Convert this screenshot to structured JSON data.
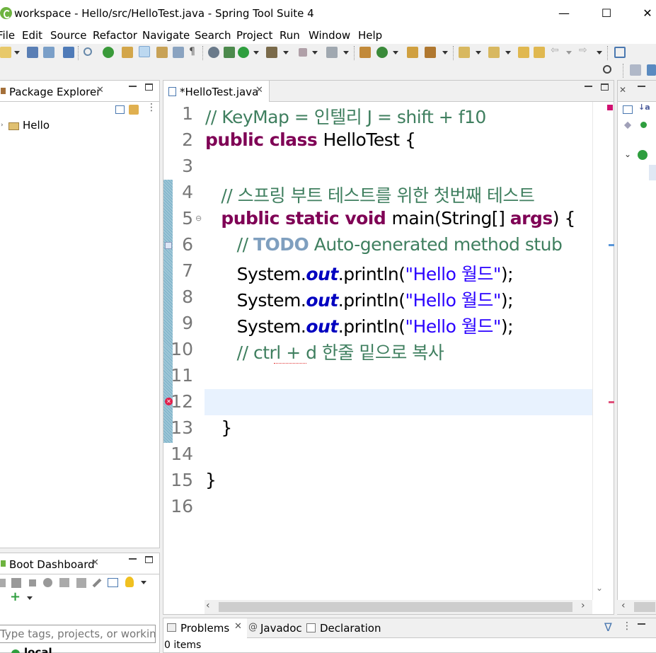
{
  "window": {
    "title": "workspace - Hello/src/HelloTest.java - Spring Tool Suite 4",
    "minimize": "—",
    "maximize": "☐",
    "close": "✕"
  },
  "menu": [
    "File",
    "Edit",
    "Source",
    "Refactor",
    "Navigate",
    "Search",
    "Project",
    "Run",
    "Window",
    "Help"
  ],
  "package_explorer": {
    "title": "Package Explorer",
    "items": [
      {
        "label": "Hello"
      }
    ]
  },
  "boot_dashboard": {
    "title": "Boot Dashboard",
    "filter_placeholder": "Type tags, projects, or working s",
    "local_label": "local"
  },
  "editor": {
    "tab_label": "*HelloTest.java",
    "line_numbers": [
      "1",
      "2",
      "3",
      "4",
      "5",
      "6",
      "7",
      "8",
      "9",
      "10",
      "11",
      "12",
      "13",
      "14",
      "15",
      "16"
    ],
    "lines": [
      {
        "segments": [
          {
            "t": "// KeyMap = 인텔리 J = shift + f10",
            "c": "cm"
          }
        ]
      },
      {
        "segments": [
          {
            "t": "public class ",
            "c": "kw"
          },
          {
            "t": "HelloTest {",
            "c": ""
          }
        ]
      },
      {
        "segments": []
      },
      {
        "segments": [
          {
            "t": "   // 스프링 부트 테스트를 위한 첫번째 테스트",
            "c": "cm"
          }
        ]
      },
      {
        "segments": [
          {
            "t": "   ",
            "c": ""
          },
          {
            "t": "public static void ",
            "c": "kw"
          },
          {
            "t": "main(String[] ",
            "c": ""
          },
          {
            "t": "args",
            "c": "kw"
          },
          {
            "t": ") {",
            "c": ""
          }
        ]
      },
      {
        "segments": [
          {
            "t": "      // ",
            "c": "cm"
          },
          {
            "t": "TODO",
            "c": "todo"
          },
          {
            "t": " Auto-generated method stub",
            "c": "cm"
          }
        ]
      },
      {
        "segments": [
          {
            "t": "      System.",
            "c": ""
          },
          {
            "t": "out",
            "c": "fld"
          },
          {
            "t": ".println(",
            "c": ""
          },
          {
            "t": "\"Hello 월드\"",
            "c": "str"
          },
          {
            "t": ");",
            "c": ""
          }
        ]
      },
      {
        "segments": [
          {
            "t": "      System.",
            "c": ""
          },
          {
            "t": "out",
            "c": "fld"
          },
          {
            "t": ".println(",
            "c": ""
          },
          {
            "t": "\"Hello 월드\"",
            "c": "str"
          },
          {
            "t": ");",
            "c": ""
          }
        ]
      },
      {
        "segments": [
          {
            "t": "      System.",
            "c": ""
          },
          {
            "t": "out",
            "c": "fld"
          },
          {
            "t": ".println(",
            "c": ""
          },
          {
            "t": "\"Hello 월드\"",
            "c": "str"
          },
          {
            "t": ");",
            "c": ""
          }
        ]
      },
      {
        "segments": [
          {
            "t": "      // ctrl + d 한줄 밑으로 복사",
            "c": "cm"
          }
        ]
      },
      {
        "segments": []
      },
      {
        "segments": []
      },
      {
        "segments": [
          {
            "t": "   }",
            "c": ""
          }
        ]
      },
      {
        "segments": []
      },
      {
        "segments": [
          {
            "t": "}",
            "c": ""
          }
        ]
      },
      {
        "segments": []
      }
    ]
  },
  "bottom_panel": {
    "tabs": [
      {
        "label": "Problems"
      },
      {
        "label": "Javadoc"
      },
      {
        "label": "Declaration"
      }
    ],
    "status": "0 items"
  },
  "colors": {
    "keyword": "#7f0055",
    "comment": "#3f7f5f",
    "string": "#2a00ff",
    "field": "#0000c0",
    "current_line": "#e8f2fe",
    "error": "#e0204b"
  }
}
